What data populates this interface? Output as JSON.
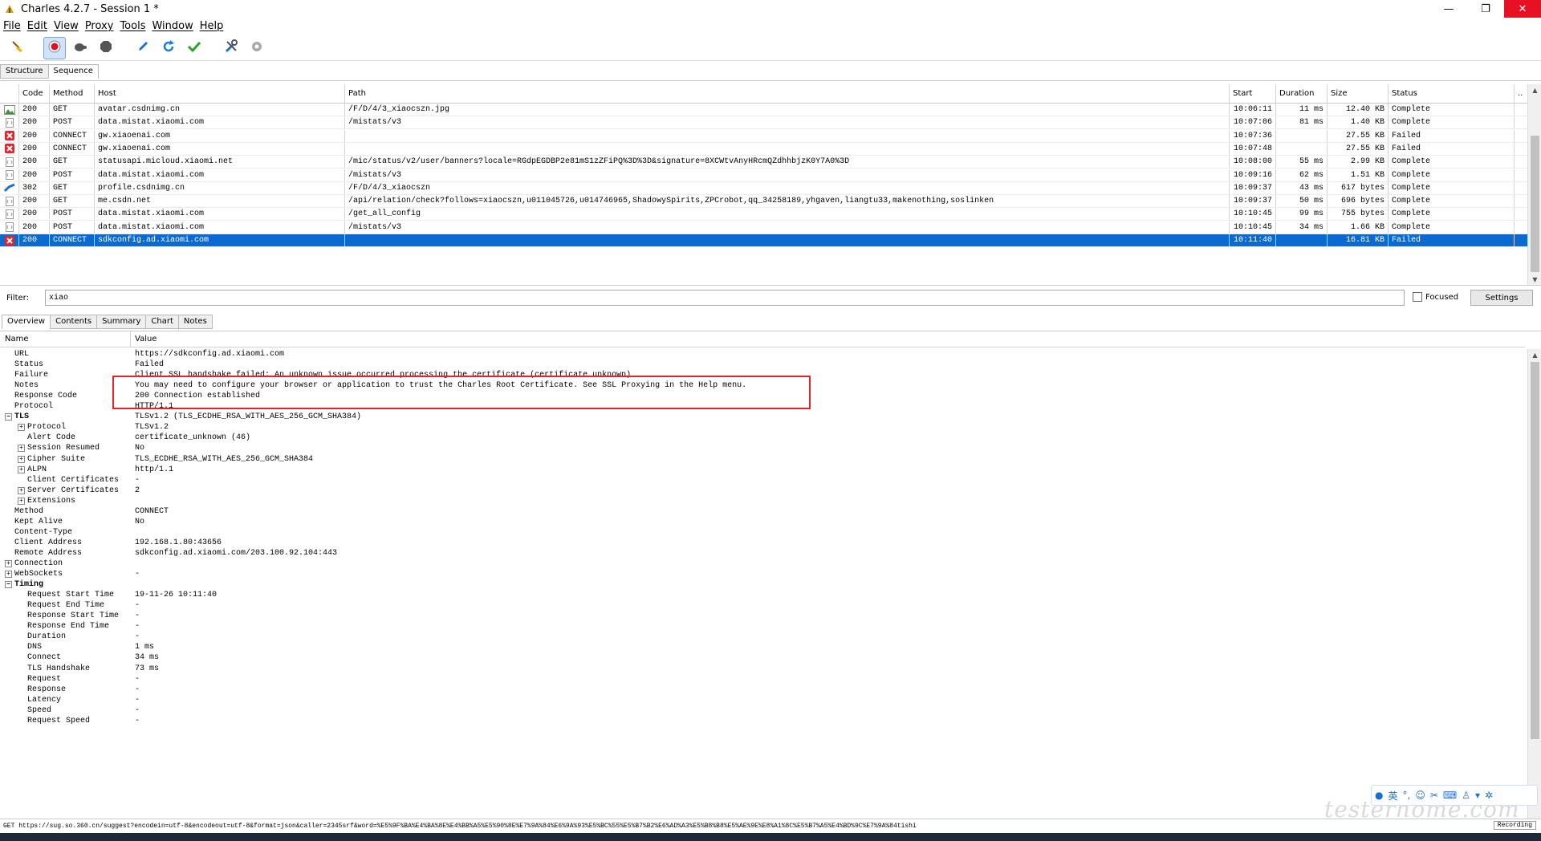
{
  "window": {
    "title": "Charles 4.2.7 - Session 1 *",
    "controls": [
      "minimize",
      "restore",
      "close"
    ]
  },
  "menu": [
    "File",
    "Edit",
    "View",
    "Proxy",
    "Tools",
    "Window",
    "Help"
  ],
  "toolbar": [
    {
      "name": "broom-icon",
      "tip": "clear"
    },
    {
      "name": "record-icon",
      "tip": "record",
      "active": true
    },
    {
      "name": "turtle-icon",
      "tip": "throttle"
    },
    {
      "name": "stop-hexagon-icon",
      "tip": "breakpoints"
    },
    {
      "name": "pen-icon",
      "tip": "compose"
    },
    {
      "name": "refresh-icon",
      "tip": "repeat"
    },
    {
      "name": "check-icon",
      "tip": "validate"
    },
    {
      "name": "tools-icon",
      "tip": "tools"
    },
    {
      "name": "gear-icon",
      "tip": "settings"
    }
  ],
  "view_tabs": [
    "Structure",
    "Sequence"
  ],
  "view_tab_selected": 1,
  "sequence": {
    "columns": [
      "Code",
      "Method",
      "Host",
      "Path",
      "Start",
      "Duration",
      "Size",
      "Status"
    ],
    "rows": [
      {
        "icon": "image",
        "code": "200",
        "method": "GET",
        "host": "avatar.csdnimg.cn",
        "path": "/F/D/4/3_xiaocszn.jpg",
        "start": "10:06:11",
        "duration": "11 ms",
        "size": "12.40 KB",
        "status": "Complete"
      },
      {
        "icon": "doc",
        "code": "200",
        "method": "POST",
        "host": "data.mistat.xiaomi.com",
        "path": "/mistats/v3",
        "start": "10:07:06",
        "duration": "81 ms",
        "size": "1.40 KB",
        "status": "Complete"
      },
      {
        "icon": "error",
        "code": "200",
        "method": "CONNECT",
        "host": "gw.xiaoenai.com",
        "path": "",
        "start": "10:07:36",
        "duration": "",
        "size": "27.55 KB",
        "status": "Failed"
      },
      {
        "icon": "error",
        "code": "200",
        "method": "CONNECT",
        "host": "gw.xiaoenai.com",
        "path": "",
        "start": "10:07:48",
        "duration": "",
        "size": "27.55 KB",
        "status": "Failed"
      },
      {
        "icon": "doc",
        "code": "200",
        "method": "GET",
        "host": "statusapi.micloud.xiaomi.net",
        "path": "/mic/status/v2/user/banners?locale=RGdpEGDBP2e81mS1zZFiPQ%3D%3D&signature=8XCWtvAnyHRcmQZdhhbjzK0Y7A0%3D",
        "start": "10:08:00",
        "duration": "55 ms",
        "size": "2.99 KB",
        "status": "Complete"
      },
      {
        "icon": "doc",
        "code": "200",
        "method": "POST",
        "host": "data.mistat.xiaomi.com",
        "path": "/mistats/v3",
        "start": "10:09:16",
        "duration": "62 ms",
        "size": "1.51 KB",
        "status": "Complete"
      },
      {
        "icon": "redirect",
        "code": "302",
        "method": "GET",
        "host": "profile.csdnimg.cn",
        "path": "/F/D/4/3_xiaocszn",
        "start": "10:09:37",
        "duration": "43 ms",
        "size": "617 bytes",
        "status": "Complete"
      },
      {
        "icon": "doc",
        "code": "200",
        "method": "GET",
        "host": "me.csdn.net",
        "path": "/api/relation/check?follows=xiaocszn,u011045726,u014746965,ShadowySpirits,ZPCrobot,qq_34258189,yhgaven,liangtu33,makenothing,soslinken",
        "start": "10:09:37",
        "duration": "50 ms",
        "size": "696 bytes",
        "status": "Complete"
      },
      {
        "icon": "doc",
        "code": "200",
        "method": "POST",
        "host": "data.mistat.xiaomi.com",
        "path": "/get_all_config",
        "start": "10:10:45",
        "duration": "99 ms",
        "size": "755 bytes",
        "status": "Complete"
      },
      {
        "icon": "doc",
        "code": "200",
        "method": "POST",
        "host": "data.mistat.xiaomi.com",
        "path": "/mistats/v3",
        "start": "10:10:45",
        "duration": "34 ms",
        "size": "1.66 KB",
        "status": "Complete"
      },
      {
        "icon": "error",
        "code": "200",
        "method": "CONNECT",
        "host": "sdkconfig.ad.xiaomi.com",
        "path": "",
        "start": "10:11:40",
        "duration": "",
        "size": "16.81 KB",
        "status": "Failed",
        "selected": true
      }
    ]
  },
  "filter": {
    "label": "Filter:",
    "value": "xiao",
    "focused_label": "Focused",
    "settings_label": "Settings"
  },
  "detail_tabs": [
    "Overview",
    "Contents",
    "Summary",
    "Chart",
    "Notes"
  ],
  "detail_tab_selected": 0,
  "overview": {
    "columns": [
      "Name",
      "Value"
    ],
    "rows": [
      {
        "name": "URL",
        "value": "https://sdkconfig.ad.xiaomi.com",
        "level": 1
      },
      {
        "name": "Status",
        "value": "Failed",
        "level": 1
      },
      {
        "name": "Failure",
        "value": "Client SSL handshake failed: An unknown issue occurred processing the certificate (certificate_unknown)",
        "level": 1
      },
      {
        "name": "Notes",
        "value": "You may need to configure your browser or application to trust the Charles Root Certificate. See SSL Proxying in the Help menu.",
        "level": 1
      },
      {
        "name": "Response Code",
        "value": "200 Connection established",
        "level": 1
      },
      {
        "name": "Protocol",
        "value": "HTTP/1.1",
        "level": 1
      },
      {
        "name": "TLS",
        "value": "TLSv1.2 (TLS_ECDHE_RSA_WITH_AES_256_GCM_SHA384)",
        "level": 0,
        "expand": "-",
        "bold": true
      },
      {
        "name": "Protocol",
        "value": "TLSv1.2",
        "level": 2,
        "expand": "+"
      },
      {
        "name": "Alert Code",
        "value": "certificate_unknown (46)",
        "level": 2
      },
      {
        "name": "Session Resumed",
        "value": "No",
        "level": 2,
        "expand": "+"
      },
      {
        "name": "Cipher Suite",
        "value": "TLS_ECDHE_RSA_WITH_AES_256_GCM_SHA384",
        "level": 2,
        "expand": "+"
      },
      {
        "name": "ALPN",
        "value": "http/1.1",
        "level": 2,
        "expand": "+"
      },
      {
        "name": "Client Certificates",
        "value": "-",
        "level": 2
      },
      {
        "name": "Server Certificates",
        "value": "2",
        "level": 2,
        "expand": "+"
      },
      {
        "name": "Extensions",
        "value": "",
        "level": 2,
        "expand": "+"
      },
      {
        "name": "Method",
        "value": "CONNECT",
        "level": 1
      },
      {
        "name": "Kept Alive",
        "value": "No",
        "level": 1
      },
      {
        "name": "Content-Type",
        "value": "",
        "level": 1
      },
      {
        "name": "Client Address",
        "value": "192.168.1.80:43656",
        "level": 1
      },
      {
        "name": "Remote Address",
        "value": "sdkconfig.ad.xiaomi.com/203.100.92.104:443",
        "level": 1
      },
      {
        "name": "Connection",
        "value": "",
        "level": 0,
        "expand": "+"
      },
      {
        "name": "WebSockets",
        "value": "-",
        "level": 0,
        "expand": "+"
      },
      {
        "name": "Timing",
        "value": "",
        "level": 0,
        "expand": "-",
        "bold": true
      },
      {
        "name": "Request Start Time",
        "value": "19-11-26 10:11:40",
        "level": 2
      },
      {
        "name": "Request End Time",
        "value": "-",
        "level": 2
      },
      {
        "name": "Response Start Time",
        "value": "-",
        "level": 2
      },
      {
        "name": "Response End Time",
        "value": "-",
        "level": 2
      },
      {
        "name": "Duration",
        "value": "-",
        "level": 2
      },
      {
        "name": "DNS",
        "value": "1 ms",
        "level": 2
      },
      {
        "name": "Connect",
        "value": "34 ms",
        "level": 2
      },
      {
        "name": "TLS Handshake",
        "value": "73 ms",
        "level": 2
      },
      {
        "name": "Request",
        "value": "-",
        "level": 2
      },
      {
        "name": "Response",
        "value": "-",
        "level": 2
      },
      {
        "name": "Latency",
        "value": "-",
        "level": 2
      },
      {
        "name": "Speed",
        "value": "-",
        "level": 2
      },
      {
        "name": "Request Speed",
        "value": "-",
        "level": 2
      }
    ]
  },
  "statusbar": {
    "text": "GET https://sug.so.360.cn/suggest?encodein=utf-8&encodeout=utf-8&format=json&caller=2345srf&word=%E5%9F%BA%E4%BA%8E%E4%BB%A5%E5%90%8E%E7%9A%84%E6%9A%93%E5%BC%55%E5%B7%B2%E6%AD%A3%E5%B8%B8%E5%AE%9E%E8%A1%8C%E5%B7%A5%E4%BD%9C%E7%9A%84tishi",
    "recording_label": "Recording"
  },
  "ime": {
    "label": "英"
  },
  "watermark": "testerhome.com",
  "colors": {
    "selection": "#0a6ad2",
    "error": "#e8222a",
    "highlight_box": "#e8222a"
  }
}
